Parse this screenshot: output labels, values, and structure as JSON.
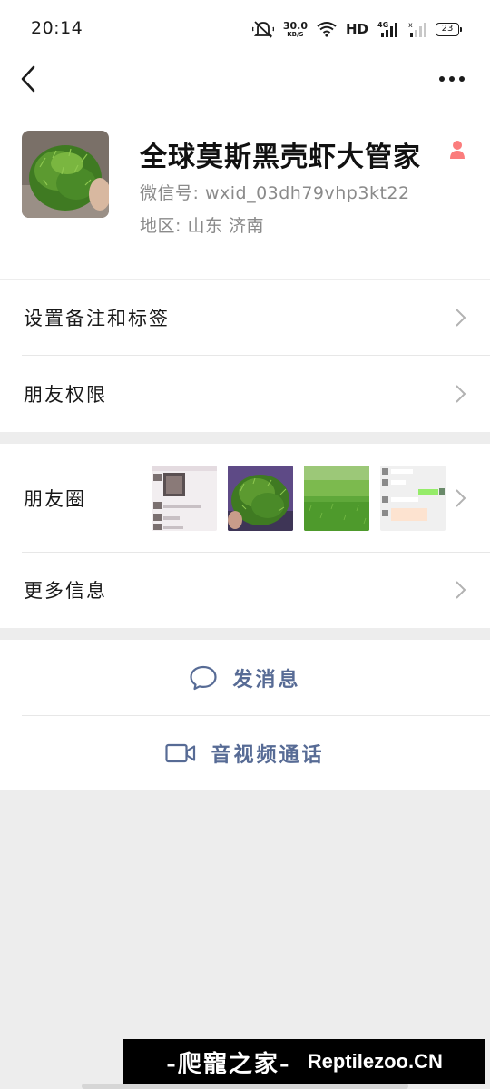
{
  "status_bar": {
    "time": "20:14",
    "net_speed": "30.0",
    "net_speed_unit": "KB/S",
    "hd_label": "HD",
    "battery": "23",
    "icons": [
      "mute-icon",
      "wifi-icon",
      "signal-4g-icon",
      "signal-icon",
      "battery-icon"
    ]
  },
  "nav": {
    "back_icon": "chevron-left-icon",
    "more_icon": "ellipsis-icon"
  },
  "profile": {
    "name": "全球莫斯黑壳虾大管家",
    "gender_icon": "female-icon",
    "wxid": "微信号: wxid_03dh79vhp3kt22",
    "region": "地区: 山东  济南"
  },
  "menu": {
    "remark_tags": "设置备注和标签",
    "friend_permissions": "朋友权限",
    "moments": "朋友圈",
    "more_info": "更多信息"
  },
  "actions": {
    "send_message": "发消息",
    "video_call": "音视频通话"
  },
  "watermark": {
    "cn": "-爬寵之家-",
    "en": "Reptilezoo.CN"
  },
  "colors": {
    "link": "#576b95",
    "background": "#ededed",
    "gender": "#fa5151"
  }
}
